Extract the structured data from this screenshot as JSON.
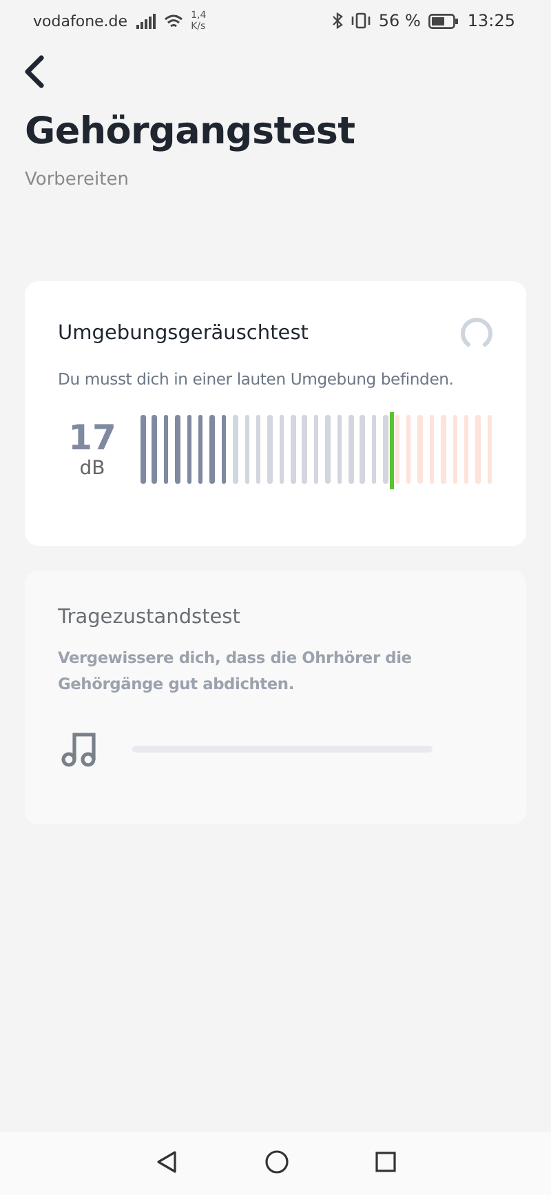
{
  "status_bar": {
    "carrier": "vodafone.de",
    "speed_value": "1,4",
    "speed_unit": "K/s",
    "battery": "56 %",
    "time": "13:25"
  },
  "header": {
    "title": "Gehörgangstest",
    "subtitle": "Vorbereiten"
  },
  "cards": [
    {
      "kind": "noise",
      "title": "Umgebungsgeräuschtest",
      "description": "Du musst dich in einer lauten Umgebung befinden.",
      "disabled": false,
      "reading": "17",
      "unit": "dB"
    },
    {
      "kind": "fit",
      "title": "Tragezustandstest",
      "description": "Vergewissere dich, dass die Ohrhörer die Gehörgänge gut abdichten.",
      "disabled": true
    }
  ]
}
